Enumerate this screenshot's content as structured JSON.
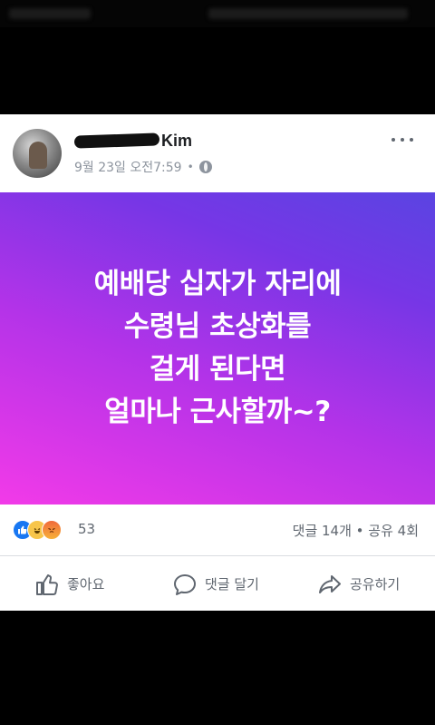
{
  "post": {
    "author": "Kim",
    "timestamp": "9월 23일 오전7:59",
    "separator": "•",
    "message_lines": [
      "예배당 십자가 자리에",
      "수령님 초상화를",
      "걸게 된다면",
      "얼마나 근사할까~?"
    ],
    "reactions": {
      "count": "53",
      "icons": [
        "like-reaction",
        "haha-reaction",
        "angry-reaction"
      ]
    },
    "stats": "댓글 14개 • 공유 4회",
    "actions": {
      "like_label": "좋아요",
      "comment_label": "댓글 달기",
      "share_label": "공유하기"
    }
  },
  "colors": {
    "banner_gradient": [
      "#f23ae8",
      "#b433e8",
      "#7736e6",
      "#5a44e2"
    ],
    "like_blue": "#1877f2",
    "secondary_text": "#606770"
  }
}
